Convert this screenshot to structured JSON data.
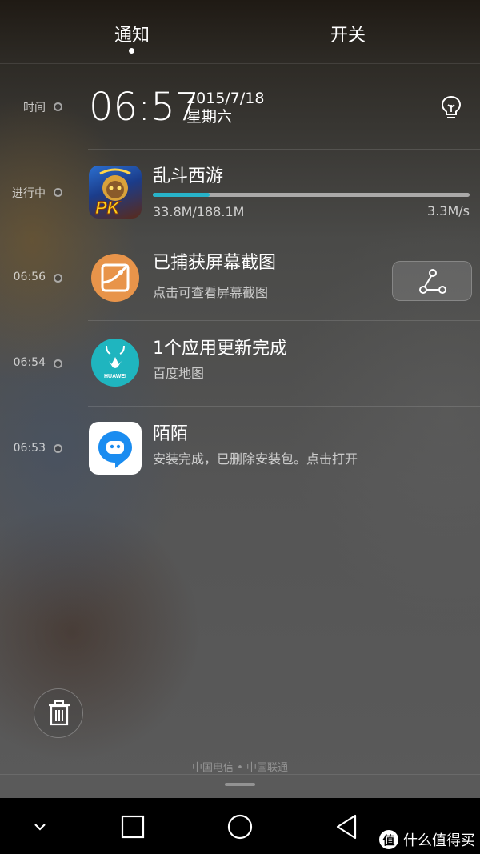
{
  "tabs": {
    "notifications": "通知",
    "toggles": "开关"
  },
  "timeline": {
    "time_label": "时间",
    "ongoing_label": "进行中",
    "times": [
      "06:56",
      "06:54",
      "06:53"
    ]
  },
  "clock": {
    "time": "06:57",
    "date": "2015/7/18",
    "weekday": "星期六",
    "bulb_icon": "lightbulb-icon"
  },
  "download": {
    "title": "乱斗西游",
    "icon_text": "PK",
    "progress_text": "33.8M/188.1M",
    "progress_fraction": 0.18,
    "speed": "3.3M/s"
  },
  "notifications": [
    {
      "title": "已捕获屏幕截图",
      "subtitle": "点击可查看屏幕截图",
      "icon": "image-icon",
      "action_icon": "share-icon"
    },
    {
      "title": "1个应用更新完成",
      "subtitle": "百度地图",
      "icon": "huawei-appgallery-icon",
      "icon_text": "HUAWEI"
    },
    {
      "title": "陌陌",
      "subtitle": "安装完成，已删除安装包。点击打开",
      "icon": "momo-icon"
    }
  ],
  "carrier": "中国电信 • 中国联通",
  "colors": {
    "progress": "#27b3c9",
    "screenshot_icon": "#e8944a",
    "appgallery_icon": "#1fb5bf",
    "momo_icon": "#1a8cf0"
  },
  "navbar": {
    "icons": [
      "collapse-icon",
      "recent-apps-icon",
      "home-icon",
      "back-icon"
    ]
  },
  "watermark": {
    "badge": "值",
    "text": "什么值得买"
  }
}
